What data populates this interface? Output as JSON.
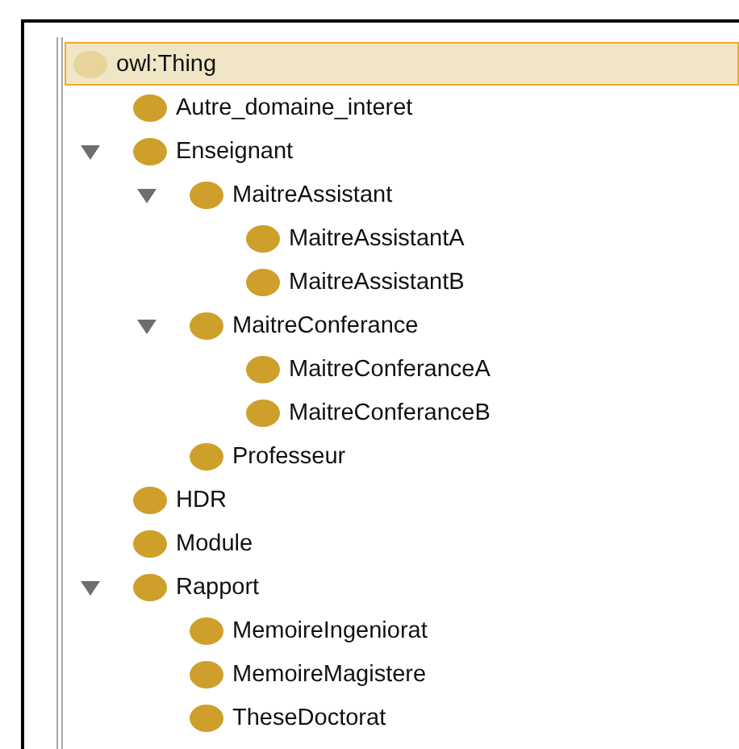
{
  "class_tree": [
    {
      "label": "owl:Thing",
      "selected": true,
      "children": [
        {
          "label": "Autre_domaine_interet",
          "selected": false
        },
        {
          "label": "Enseignant",
          "selected": false,
          "expanded": true,
          "children": [
            {
              "label": "MaitreAssistant",
              "selected": false,
              "expanded": true,
              "children": [
                {
                  "label": "MaitreAssistantA",
                  "selected": false
                },
                {
                  "label": "MaitreAssistantB",
                  "selected": false
                }
              ]
            },
            {
              "label": "MaitreConferance",
              "selected": false,
              "expanded": true,
              "children": [
                {
                  "label": "MaitreConferanceA",
                  "selected": false
                },
                {
                  "label": "MaitreConferanceB",
                  "selected": false
                }
              ]
            },
            {
              "label": "Professeur",
              "selected": false
            }
          ]
        },
        {
          "label": "HDR",
          "selected": false
        },
        {
          "label": "Module",
          "selected": false
        },
        {
          "label": "Rapport",
          "selected": false,
          "expanded": true,
          "children": [
            {
              "label": "MemoireIngeniorat",
              "selected": false
            },
            {
              "label": "MemoireMagistere",
              "selected": false
            },
            {
              "label": "TheseDoctorat",
              "selected": false
            }
          ]
        }
      ]
    }
  ]
}
